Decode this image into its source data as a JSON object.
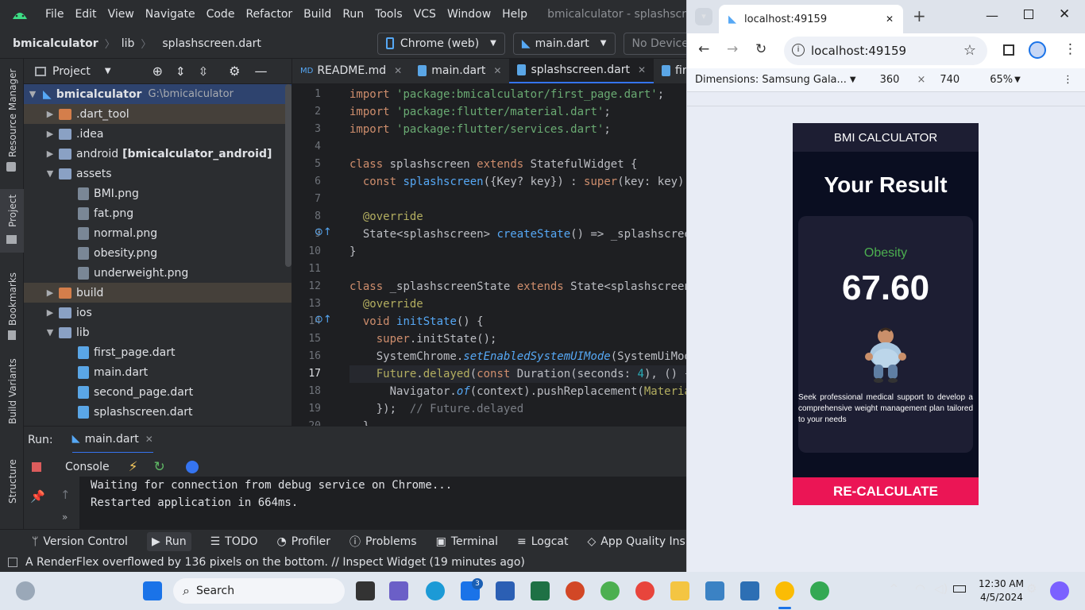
{
  "ide": {
    "menu": [
      "File",
      "Edit",
      "View",
      "Navigate",
      "Code",
      "Refactor",
      "Build",
      "Run",
      "Tools",
      "VCS",
      "Window",
      "Help"
    ],
    "window_title": "bmicalculator - splashscreen.dart",
    "breadcrumb": {
      "project": "bmicalculator",
      "folder": "lib",
      "file": "splashscreen.dart"
    },
    "device_selector": "Chrome (web)",
    "run_config": "main.dart",
    "no_devices": "No Devices",
    "side_labels": {
      "resource_manager": "Resource Manager",
      "project": "Project",
      "bookmarks": "Bookmarks",
      "build_variants": "Build Variants",
      "structure": "Structure"
    },
    "project_panel": {
      "title": "Project",
      "root_name": "bmicalculator",
      "root_path": "G:\\bmicalculator",
      "items": [
        {
          "label": "dart_tool",
          "prefix": ".",
          "level": 1,
          "type": "folder-orange",
          "arrow": "right"
        },
        {
          "label": "idea",
          "prefix": ".",
          "level": 1,
          "type": "folder",
          "arrow": "right"
        },
        {
          "label": "android",
          "suffix": "[bmicalculator_android]",
          "level": 1,
          "type": "folder",
          "arrow": "right"
        },
        {
          "label": "assets",
          "level": 1,
          "type": "folder",
          "arrow": "down"
        },
        {
          "label": "BMI.png",
          "level": 2,
          "type": "img"
        },
        {
          "label": "fat.png",
          "level": 2,
          "type": "img"
        },
        {
          "label": "normal.png",
          "level": 2,
          "type": "img"
        },
        {
          "label": "obesity.png",
          "level": 2,
          "type": "img"
        },
        {
          "label": "underweight.png",
          "level": 2,
          "type": "img"
        },
        {
          "label": "build",
          "level": 1,
          "type": "folder-orange",
          "arrow": "right"
        },
        {
          "label": "ios",
          "level": 1,
          "type": "folder",
          "arrow": "right"
        },
        {
          "label": "lib",
          "level": 1,
          "type": "folder",
          "arrow": "down"
        },
        {
          "label": "first_page.dart",
          "level": 2,
          "type": "dart"
        },
        {
          "label": "main.dart",
          "level": 2,
          "type": "dart"
        },
        {
          "label": "second_page.dart",
          "level": 2,
          "type": "dart"
        },
        {
          "label": "splashscreen.dart",
          "level": 2,
          "type": "dart"
        }
      ]
    },
    "editor_tabs": [
      "README.md",
      "main.dart",
      "splashscreen.dart",
      "first_page"
    ],
    "line_numbers": [
      "1",
      "2",
      "3",
      "4",
      "5",
      "6",
      "7",
      "8",
      "9",
      "10",
      "11",
      "12",
      "13",
      "14",
      "15",
      "16",
      "17",
      "18",
      "19",
      "20"
    ],
    "run_panel": {
      "label": "Run:",
      "config": "main.dart",
      "console_tab": "Console",
      "console_lines": [
        "Waiting for connection from debug service on Chrome...",
        "Restarted application in 664ms."
      ]
    },
    "bottom_tabs": [
      "Version Control",
      "Run",
      "TODO",
      "Profiler",
      "Problems",
      "Terminal",
      "Logcat",
      "App Quality Insights"
    ],
    "status_message": "A RenderFlex overflowed by 136 pixels on the bottom. // Inspect Widget (19 minutes ago)"
  },
  "browser": {
    "tab_title": "localhost:49159",
    "url": "localhost:49159",
    "device_toolbar": {
      "dimensions_label": "Dimensions: Samsung Gala...",
      "width": "360",
      "x": "×",
      "height": "740",
      "zoom": "65%"
    },
    "app": {
      "appbar_title": "BMI CALCULATOR",
      "heading": "Your Result",
      "status": "Obesity",
      "bmi_value": "67.60",
      "advice": "Seek professional medical support to develop a comprehensive weight management plan tailored to your needs",
      "button": "RE-CALCULATE"
    }
  },
  "taskbar": {
    "search_label": "Search",
    "time": "12:30 AM",
    "date": "4/5/2024",
    "mail_badge": "3"
  },
  "colors": {
    "accent": "#eb1555",
    "card": "#1d1e33",
    "app_bg": "#0a0e21",
    "status_green": "#4caf50"
  }
}
